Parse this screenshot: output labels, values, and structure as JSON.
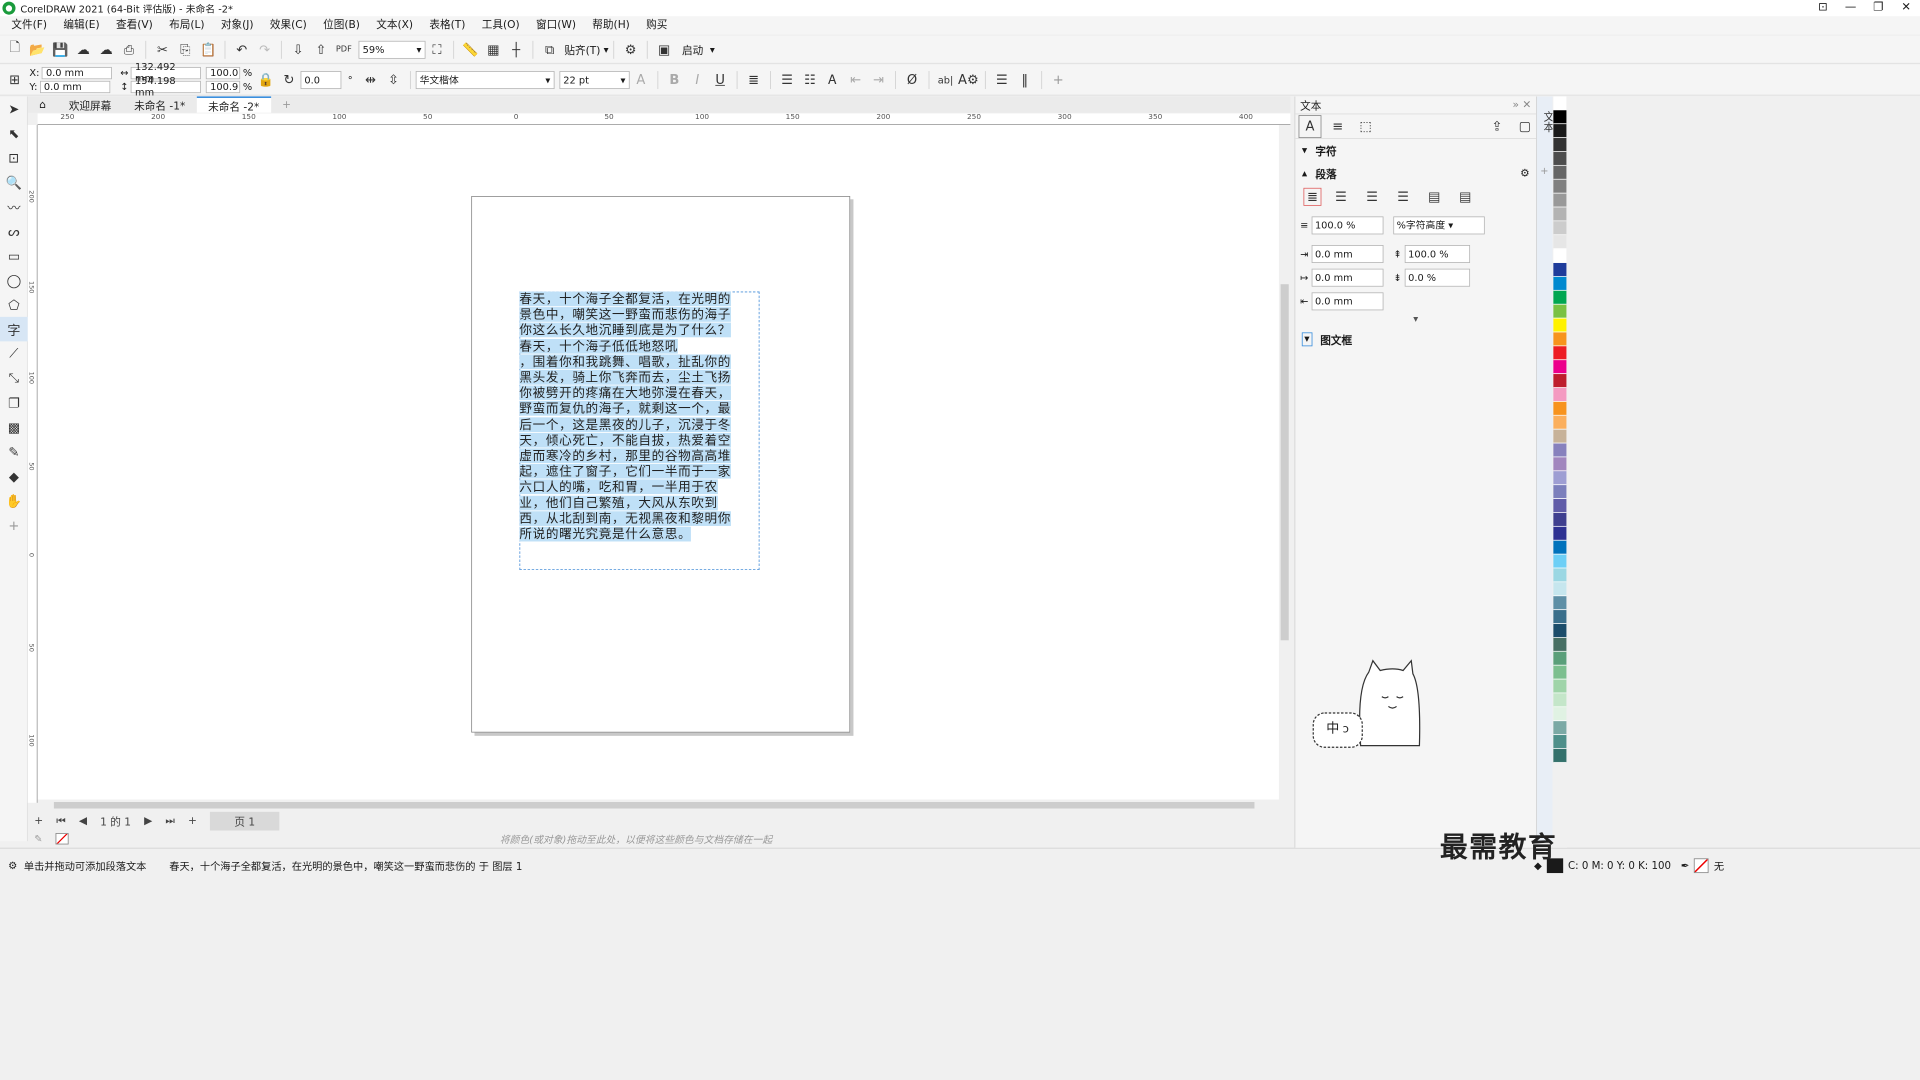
{
  "window": {
    "title": "CorelDRAW 2021 (64-Bit 评估版) - 未命名 -2*",
    "controls": [
      "⊡",
      "—",
      "❐",
      "✕"
    ]
  },
  "menu": [
    "文件(F)",
    "编辑(E)",
    "查看(V)",
    "布局(L)",
    "对象(J)",
    "效果(C)",
    "位图(B)",
    "文本(X)",
    "表格(T)",
    "工具(O)",
    "窗口(W)",
    "帮助(H)",
    "购买"
  ],
  "toolbar": {
    "zoom": "59%",
    "snap_label": "贴齐(T)",
    "launch_label": "启动"
  },
  "propbar": {
    "x_label": "X:",
    "x_value": "0.0 mm",
    "y_label": "Y:",
    "y_value": "0.0 mm",
    "w_value": "132.492 mm",
    "h_value": "154.198 mm",
    "sx_value": "100.0",
    "sy_value": "100.9",
    "pct1": "%",
    "pct2": "%",
    "rotation": "0.0",
    "font": "华文楷体",
    "size": "22 pt"
  },
  "tabs": [
    {
      "label": "欢迎屏幕",
      "active": false
    },
    {
      "label": "未命名 -1*",
      "active": false
    },
    {
      "label": "未命名 -2*",
      "active": true
    }
  ],
  "ruler_h": [
    "250",
    "200",
    "150",
    "100",
    "50",
    "0",
    "50",
    "100",
    "150",
    "200",
    "250",
    "300",
    "350",
    "400"
  ],
  "ruler_v": [
    "200",
    "150",
    "100",
    "50",
    "0",
    "50",
    "100",
    "150",
    "200"
  ],
  "document_text": [
    "春天，十个海子全都复活，在光明的",
    "景色中，嘲笑这一野蛮而悲伤的海子",
    "你这么长久地沉睡到底是为了什么？",
    "春天，十个海子低低地怒吼",
    "，围着你和我跳舞、唱歌，扯乱你的",
    "黑头发，骑上你飞奔而去，尘土飞扬",
    "你被劈开的疼痛在大地弥漫在春天，",
    "野蛮而复仇的海子，就剩这一个，最",
    "后一个，这是黑夜的儿子，沉浸于冬",
    "天，倾心死亡，不能自拔，热爱着空",
    "虚而寒冷的乡村，那里的谷物高高堆",
    "起，遮住了窗子，它们一半而于一家",
    "六口人的嘴，吃和胃，一半用于农",
    "业，他们自己繁殖，大风从东吹到",
    "西，从北刮到南，无视黑夜和黎明你",
    "所说的曙光究竟是什么意思。"
  ],
  "pagenav": {
    "page_of": "1 的 1",
    "page_tab": "页 1"
  },
  "color_hint": "将颜色(或对象)拖动至此处，以便将这些颜色与文档存储在一起",
  "status": {
    "hint": "单击并拖动可添加段落文本",
    "info": "春天，十个海子全都复活，在光明的景色中，嘲笑这一野蛮而悲伤的 于 图层 1",
    "cmyk": "C: 0 M: 0 Y: 0 K: 100",
    "outline": "无"
  },
  "docker": {
    "title": "文本",
    "char_label": "字符",
    "para_label": "段落",
    "line_spacing": "100.0 %",
    "spacing_unit": "%字符高度",
    "left_indent": "0.0 mm",
    "first_indent": "0.0 mm",
    "right_indent": "0.0 mm",
    "before_para": "100.0 %",
    "after_para": "0.0 %",
    "frame_label": "图文框"
  },
  "palette": [
    "#ffffff",
    "#000000",
    "#1a1a1a",
    "#333333",
    "#4d4d4d",
    "#666666",
    "#808080",
    "#999999",
    "#b3b3b3",
    "#cccccc",
    "#e6e6e6",
    "#ffffff",
    "#1f3c9b",
    "#0089cf",
    "#00a651",
    "#7ac143",
    "#fff200",
    "#f7941d",
    "#ed1c24",
    "#ec008c",
    "#be1e2d",
    "#f49ac1",
    "#f7931e",
    "#fbaf5d",
    "#c7b299",
    "#8781bd",
    "#a186be",
    "#9e9ed3",
    "#7b7fbc",
    "#605ca8",
    "#3f3f8f",
    "#2e3192",
    "#0072bc",
    "#6dcff6",
    "#9bd7e3",
    "#c6e6ee",
    "#5e8fa6",
    "#3a6f8c",
    "#1c4d6b",
    "#476f64",
    "#5a9f7a",
    "#7cbf8f",
    "#9fd4a9",
    "#c4e6c9",
    "#e0f2e3",
    "#7ba9a5",
    "#4e8f8a",
    "#34716c"
  ],
  "watermark": "最需教育"
}
